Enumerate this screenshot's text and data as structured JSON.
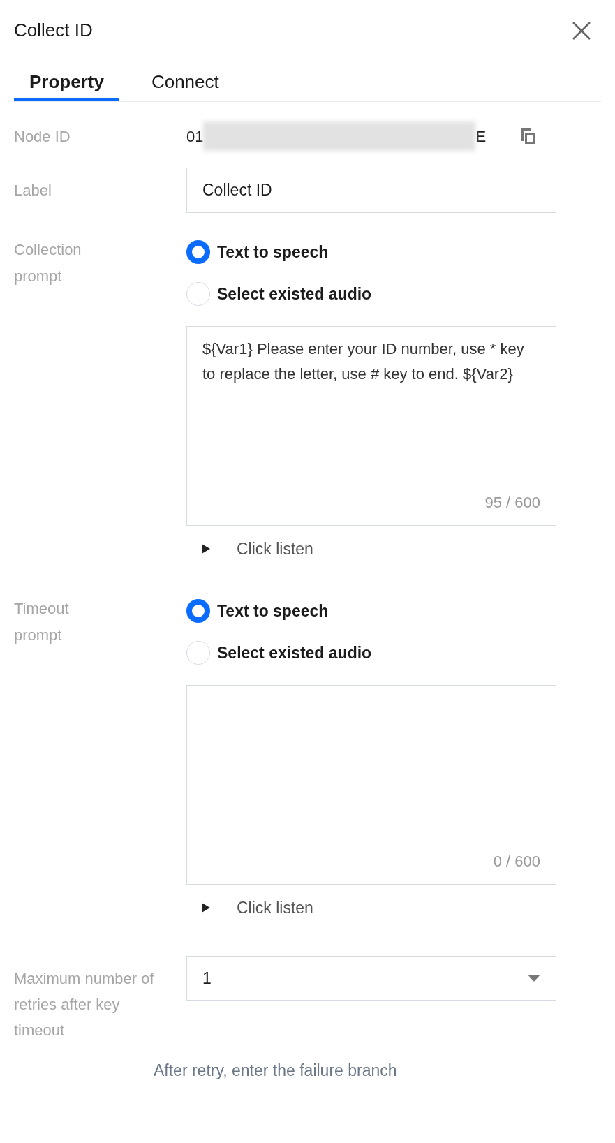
{
  "header": {
    "title": "Collect ID"
  },
  "tabs": [
    {
      "label": "Property",
      "selected": true
    },
    {
      "label": "Connect",
      "selected": false
    }
  ],
  "node_id": {
    "label": "Node ID",
    "value_start": "01",
    "value_end": "E"
  },
  "label_field": {
    "label": "Label",
    "value": "Collect ID"
  },
  "prompts": [
    {
      "label": "Collection prompt",
      "options": [
        {
          "label": "Text to speech",
          "selected": true
        },
        {
          "label": "Select existed audio",
          "selected": false
        }
      ],
      "text": "${Var1} Please enter your ID number, use * key to replace the letter, use # key to end. ${Var2}",
      "count": "95 / 600",
      "listen": "Click listen"
    },
    {
      "label": "Timeout prompt",
      "options": [
        {
          "label": "Text to speech",
          "selected": true
        },
        {
          "label": "Select existed audio",
          "selected": false
        }
      ],
      "count": "0 / 600",
      "listen": "Click listen"
    }
  ],
  "retries": {
    "label": "Maximum number of retries after key timeout",
    "value": "1",
    "hint": "After retry, enter the failure branch"
  }
}
